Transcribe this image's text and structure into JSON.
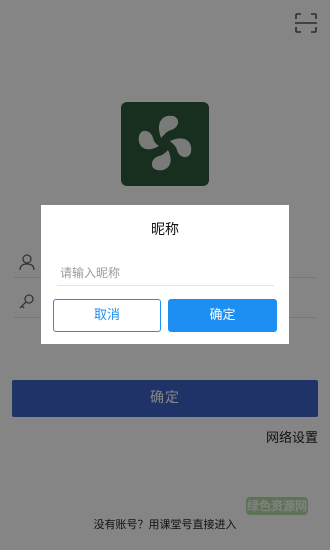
{
  "screen": {
    "scan_icon": "scan-frame-icon",
    "logo_icon": "pinwheel-logo-icon",
    "username_icon": "user-icon",
    "password_icon": "key-icon",
    "confirm_button": "确定",
    "network_settings": "网络设置",
    "no_account_link": "没有账号？用课堂号直接进入",
    "colors": {
      "logo_background": "#2e5a3c",
      "confirm_button": "#3d63c8"
    }
  },
  "dialog": {
    "title": "昵称",
    "nickname_placeholder": "请输入昵称",
    "nickname_value": "",
    "cancel_button": "取消",
    "ok_button": "确定",
    "colors": {
      "accent": "#1d8ff2"
    }
  },
  "watermark": {
    "text": "绿色资源网"
  }
}
